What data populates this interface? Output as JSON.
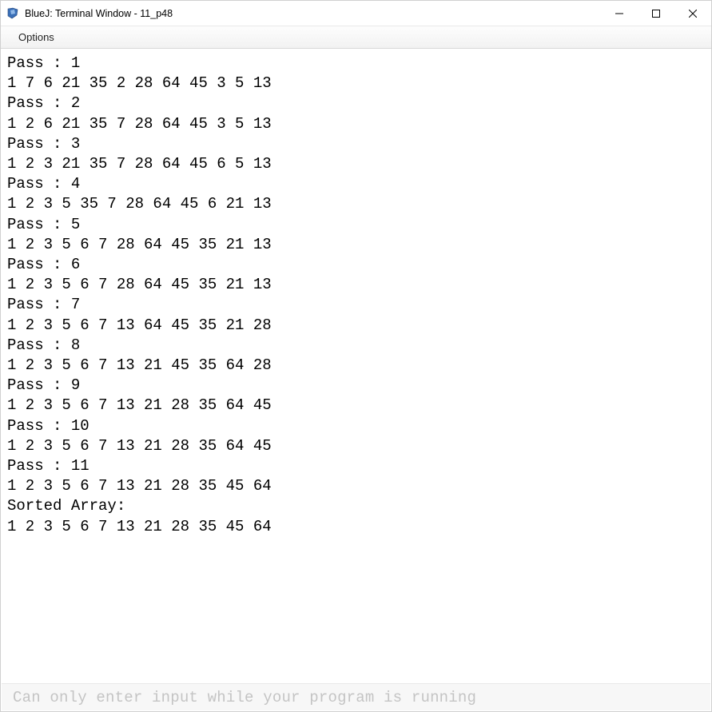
{
  "window": {
    "title": "BlueJ: Terminal Window - 11_p48"
  },
  "menubar": {
    "options_label": "Options"
  },
  "terminal": {
    "lines": [
      "Pass : 1",
      "1 7 6 21 35 2 28 64 45 3 5 13 ",
      "Pass : 2",
      "1 2 6 21 35 7 28 64 45 3 5 13 ",
      "Pass : 3",
      "1 2 3 21 35 7 28 64 45 6 5 13 ",
      "Pass : 4",
      "1 2 3 5 35 7 28 64 45 6 21 13 ",
      "Pass : 5",
      "1 2 3 5 6 7 28 64 45 35 21 13 ",
      "Pass : 6",
      "1 2 3 5 6 7 28 64 45 35 21 13 ",
      "Pass : 7",
      "1 2 3 5 6 7 13 64 45 35 21 28 ",
      "Pass : 8",
      "1 2 3 5 6 7 13 21 45 35 64 28 ",
      "Pass : 9",
      "1 2 3 5 6 7 13 21 28 35 64 45 ",
      "Pass : 10",
      "1 2 3 5 6 7 13 21 28 35 64 45 ",
      "Pass : 11",
      "1 2 3 5 6 7 13 21 28 35 45 64 ",
      "Sorted Array:",
      "1 2 3 5 6 7 13 21 28 35 45 64 "
    ]
  },
  "inputbar": {
    "placeholder": "Can only enter input while your program is running"
  }
}
